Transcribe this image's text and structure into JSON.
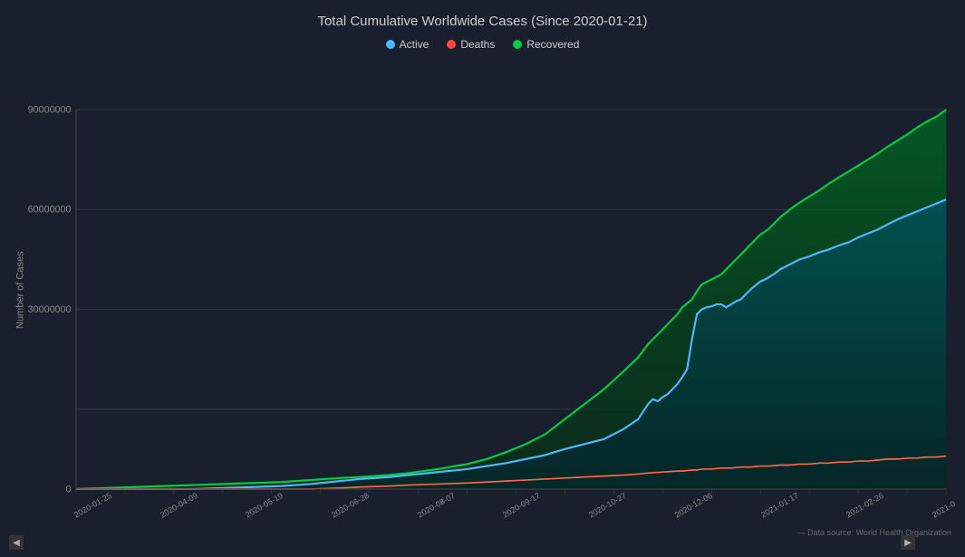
{
  "chart": {
    "title": "Total Cumulative Worldwide Cases (Since 2020-01-21)",
    "yAxisLabel": "Number of Cases",
    "yTicks": [
      "90000000",
      "60000000",
      "30000000",
      "0"
    ],
    "xLabels": [
      "2020-01-25",
      "2020-04-09",
      "2020-05-19",
      "2020-06-28",
      "2020-08-07",
      "2020-09-17",
      "2020-10-27",
      "2020-12-06",
      "2021-01-17",
      "2021-02-26",
      "2021-0"
    ],
    "legend": {
      "active": {
        "label": "Active",
        "color": "#4db8ff"
      },
      "deaths": {
        "label": "Deaths",
        "color": "#ff4444"
      },
      "recovered": {
        "label": "Recovered",
        "color": "#00cc44"
      }
    },
    "footer": "— Data source: World Health Organization",
    "colors": {
      "background": "#1a1f2e",
      "gridLine": "#2a3040",
      "active": "#4db8ff",
      "deaths": "#ff6644",
      "recovered": "#00cc44",
      "recoveredFill": "rgba(0, 100, 50, 0.5)",
      "activeFill": "rgba(0, 80, 100, 0.4)"
    }
  }
}
